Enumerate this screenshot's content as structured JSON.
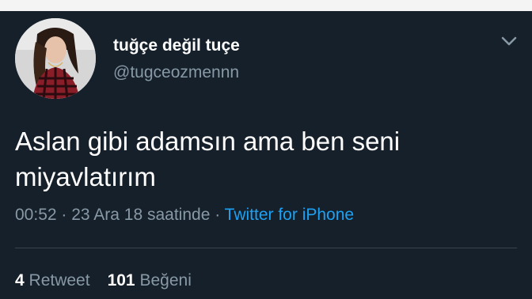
{
  "user": {
    "display_name": "tuğçe değil tuçe",
    "handle": "@tugceozmennn"
  },
  "tweet": {
    "text": "Aslan gibi adamsın ama ben seni miyavlatırım",
    "time": "00:52",
    "separator": " · ",
    "date": "23 Ara 18 saatinde",
    "source": "Twitter for iPhone"
  },
  "stats": {
    "retweet_count": "4",
    "retweet_label": "Retweet",
    "like_count": "101",
    "like_label": "Beğeni"
  },
  "icons": {
    "menu": "chevron-down-icon",
    "avatar": "profile-photo"
  },
  "colors": {
    "background": "#15202b",
    "text_primary": "#ffffff",
    "text_secondary": "#8899a6",
    "link": "#1da1f2",
    "divider": "#38444d"
  }
}
